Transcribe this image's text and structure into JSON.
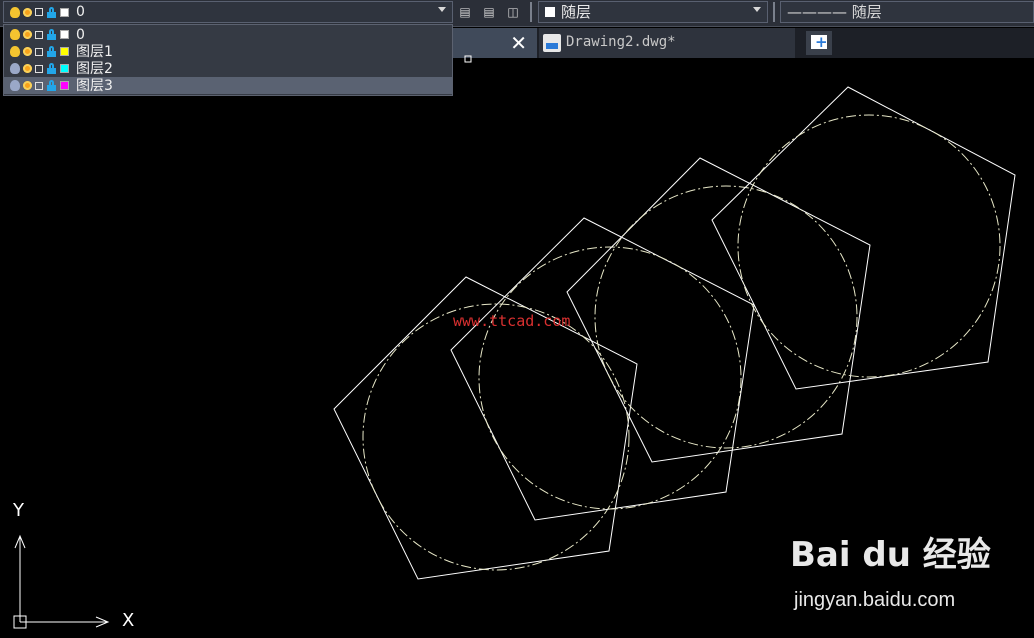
{
  "layer_toolbar": {
    "current_layer": "0",
    "current_color": "#ffffff"
  },
  "layer_dropdown": {
    "rows": [
      {
        "name": "0",
        "color": "#ffffff",
        "bulb": "on",
        "highlighted": false
      },
      {
        "name": "图层1",
        "color": "#ffff00",
        "bulb": "on",
        "highlighted": false
      },
      {
        "name": "图层2",
        "color": "#00ffff",
        "bulb": "off",
        "highlighted": false
      },
      {
        "name": "图层3",
        "color": "#ff00ff",
        "bulb": "off",
        "highlighted": true
      }
    ]
  },
  "properties": {
    "color_label": "随层",
    "linetype_label": "———— 随层"
  },
  "tabs": {
    "drawing_label": "Drawing2.dwg*"
  },
  "canvas": {
    "watermark": "www.ttcad.com",
    "ucs_x": "X",
    "ucs_y": "Y"
  },
  "branding": {
    "logo_text": "Bai du 经验",
    "url": "jingyan.baidu.com"
  }
}
